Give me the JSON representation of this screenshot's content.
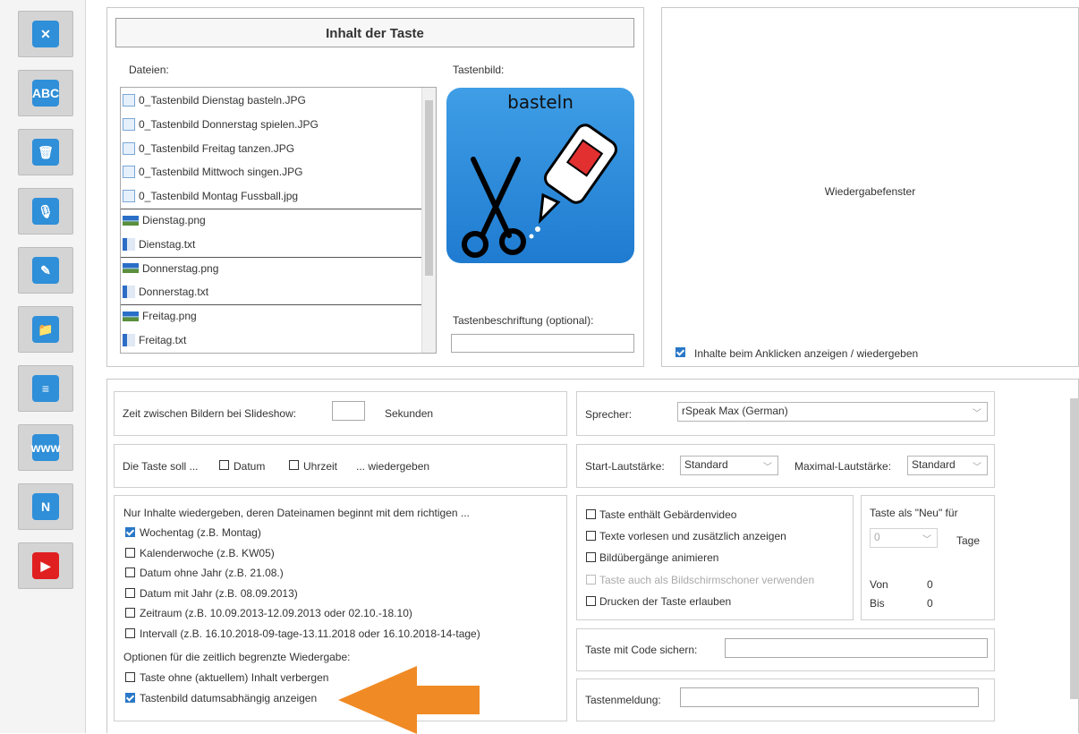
{
  "toolbar": {
    "buttons": [
      {
        "icon": "tools-icon",
        "color": "#2f8fd8",
        "glyph": "✕"
      },
      {
        "icon": "abc-eraser-icon",
        "color": "#2f8fd8",
        "glyph": "ABC"
      },
      {
        "icon": "trash-icon",
        "color": "#2f8fd8",
        "glyph": "🗑"
      },
      {
        "icon": "microphone-icon",
        "color": "#2f8fd8",
        "glyph": "🎙"
      },
      {
        "icon": "edit-note-icon",
        "color": "#2f8fd8",
        "glyph": "✎"
      },
      {
        "icon": "folder-icon",
        "color": "#2f8fd8",
        "glyph": "📁"
      },
      {
        "icon": "mixer-icon",
        "color": "#2f8fd8",
        "glyph": "≡"
      },
      {
        "icon": "www-globe-icon",
        "color": "#2f8fd8",
        "glyph": "www"
      },
      {
        "icon": "n-logo-icon",
        "color": "#2f8fd8",
        "glyph": "N"
      },
      {
        "icon": "youtube-icon",
        "color": "#e02020",
        "glyph": "▶"
      }
    ]
  },
  "content": {
    "title": "Inhalt der Taste",
    "files_label": "Dateien:",
    "image_label": "Tastenbild:",
    "files": [
      {
        "name": "0_Tastenbild Dienstag basteln.JPG",
        "type": "jpg"
      },
      {
        "name": "0_Tastenbild Donnerstag spielen.JPG",
        "type": "jpg"
      },
      {
        "name": "0_Tastenbild Freitag tanzen.JPG",
        "type": "jpg"
      },
      {
        "name": "0_Tastenbild Mittwoch singen.JPG",
        "type": "jpg"
      },
      {
        "name": "0_Tastenbild Montag Fussball.jpg",
        "type": "jpg"
      },
      {
        "name": "Dienstag.png",
        "type": "png"
      },
      {
        "name": "Dienstag.txt",
        "type": "txt"
      },
      {
        "name": "Donnerstag.png",
        "type": "png"
      },
      {
        "name": "Donnerstag.txt",
        "type": "txt"
      },
      {
        "name": "Freitag.png",
        "type": "png"
      },
      {
        "name": "Freitag.txt",
        "type": "txt"
      }
    ],
    "image_caption": "basteln",
    "caption_label": "Tastenbeschriftung (optional):",
    "caption_value": ""
  },
  "playback": {
    "window_label": "Wiedergabefenster",
    "show_on_click_label": "Inhalte beim Anklicken anzeigen / wiedergeben",
    "show_on_click_checked": true
  },
  "slideshow": {
    "label": "Zeit zwischen Bildern bei Slideshow:",
    "value": "",
    "unit": "Sekunden"
  },
  "date_output": {
    "prefix": "Die Taste soll ...",
    "datum": "Datum",
    "uhrzeit": "Uhrzeit",
    "suffix": "... wiedergeben"
  },
  "filter": {
    "heading": "Nur Inhalte wiedergeben, deren Dateinamen beginnt mit dem richtigen ...",
    "options": [
      {
        "label": "Wochentag (z.B. Montag)",
        "checked": true
      },
      {
        "label": "Kalenderwoche (z.B. KW05)",
        "checked": false
      },
      {
        "label": "Datum ohne Jahr (z.B. 21.08.)",
        "checked": false
      },
      {
        "label": "Datum mit Jahr (z.B. 08.09.2013)",
        "checked": false
      },
      {
        "label": "Zeitraum (z.B. 10.09.2013-12.09.2013 oder 02.10.-18.10)",
        "checked": false
      },
      {
        "label": "Intervall (z.B. 16.10.2018-09-tage-13.11.2018 oder 16.10.2018-14-tage)",
        "checked": false
      }
    ],
    "options_heading": "Optionen für die zeitlich begrenzte Wiedergabe:",
    "hide_label": "Taste ohne (aktuellem) Inhalt verbergen",
    "hide_checked": false,
    "date_image_label": "Tastenbild datumsabhängig anzeigen",
    "date_image_checked": true
  },
  "speech": {
    "speaker_label": "Sprecher:",
    "speaker_value": "rSpeak Max (German)",
    "start_volume_label": "Start-Lautstärke:",
    "start_volume_value": "Standard",
    "max_volume_label": "Maximal-Lautstärke:",
    "max_volume_value": "Standard"
  },
  "options": {
    "items": [
      {
        "label": "Taste enthält Gebärdenvideo",
        "checked": false,
        "disabled": false
      },
      {
        "label": "Texte vorlesen und zusätzlich anzeigen",
        "checked": false,
        "disabled": false
      },
      {
        "label": "Bildübergänge animieren",
        "checked": false,
        "disabled": false
      },
      {
        "label": "Taste auch als Bildschirmschoner verwenden",
        "checked": false,
        "disabled": true
      },
      {
        "label": "Drucken der Taste erlauben",
        "checked": false,
        "disabled": false
      }
    ]
  },
  "new_flag": {
    "heading": "Taste als \"Neu\" für",
    "days_value": "0",
    "days_unit": "Tage",
    "from_label": "Von",
    "from_value": "0",
    "to_label": "Bis",
    "to_value": "0"
  },
  "code": {
    "label": "Taste mit Code sichern:",
    "value": ""
  },
  "message": {
    "label": "Tastenmeldung:",
    "value": ""
  },
  "colors": {
    "accent": "#2a78c8",
    "arrow": "#f08a24",
    "toolbar_button": "#d4d4d4"
  }
}
